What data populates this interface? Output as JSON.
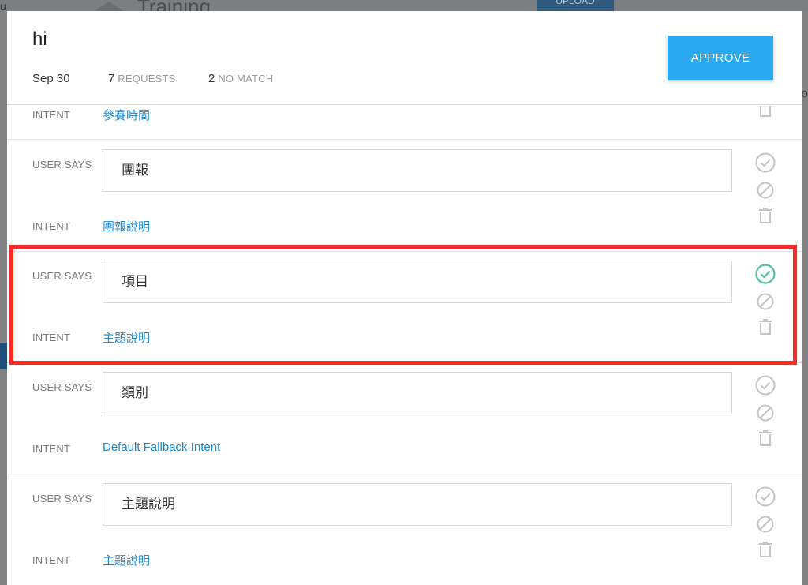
{
  "background": {
    "app_title": "Training",
    "upload_label": "UPLOAD",
    "left_fragment": "u",
    "right_fragment": "co"
  },
  "modal": {
    "title": "hi",
    "date": "Sep 30",
    "requests_count": "7",
    "requests_label": "REQUESTS",
    "nomatch_count": "2",
    "nomatch_label": "NO MATCH",
    "approve_label": "APPROVE"
  },
  "labels": {
    "user_says": "USER SAYS",
    "intent": "INTENT"
  },
  "rows": [
    {
      "intent": "參賽時間"
    },
    {
      "user_says": "團報",
      "intent": "團報說明",
      "approved": false
    },
    {
      "user_says": "項目",
      "intent": "主題說明",
      "approved": true
    },
    {
      "user_says": "類別",
      "intent": "Default Fallback Intent",
      "approved": false
    },
    {
      "user_says": "主題說明",
      "intent": "主題說明",
      "approved": false
    }
  ],
  "icons": {
    "approve": "check-circle-icon",
    "ignore": "block-icon",
    "delete": "trash-icon"
  },
  "colors": {
    "accent": "#29aaf0",
    "link": "#1c87d1",
    "approved_check": "#4fc19a",
    "icon_gray": "#c4c4c4",
    "highlight": "#fb2b24"
  }
}
